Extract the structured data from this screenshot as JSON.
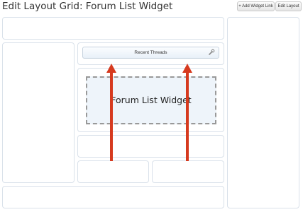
{
  "page": {
    "title": "Edit Layout Grid: Forum List Widget"
  },
  "toolbar": {
    "add_widget_link": "+ Add Widget Link",
    "edit_layout": "Edit Layout"
  },
  "widget": {
    "header_title": "Recent Threads",
    "placeholder": "Forum List Widget"
  },
  "icons": {
    "settings": "wrench-icon"
  },
  "annotation": {
    "arrow_color": "#d63a1f"
  }
}
